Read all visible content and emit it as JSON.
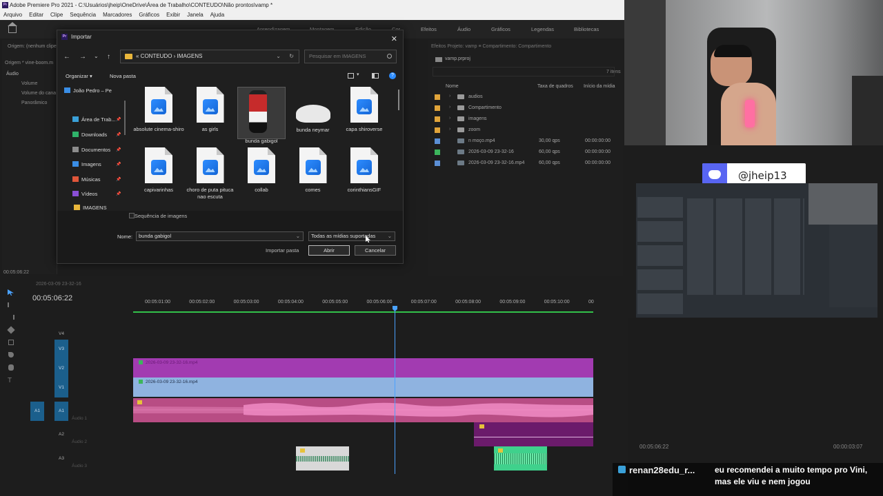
{
  "titlebar": {
    "text": "Adobe Premiere Pro 2021 - C:\\Usuários\\jheip\\OneDrive\\Área de Trabalho\\CONTEUDO\\Não prontos\\vamp *"
  },
  "menu": [
    "Arquivo",
    "Editar",
    "Clipe",
    "Sequência",
    "Marcadores",
    "Gráficos",
    "Exibir",
    "Janela",
    "Ajuda"
  ],
  "workspaces": [
    "Aprendizagem",
    "Montagem",
    "Edição",
    "Cor",
    "Efeitos",
    "Áudio",
    "Gráficos",
    "Legendas",
    "Bibliotecas"
  ],
  "source_panel": {
    "tab": "Origem: (nenhum clipe)",
    "clip": "Origem * vine-boom.m",
    "section": "Áudio",
    "rows": [
      "Volume",
      "Volume do cana",
      "Panorâmico"
    ],
    "timecode": "00:05:06:22"
  },
  "project_panel": {
    "tabs": "Efeitos    Projeto: vamp  ≡    Compartimento: Compartimento",
    "project_file": "vamp.prproj",
    "item_count": "7 itens",
    "col_name": "Nome",
    "col_fps": "Taxa de quadros",
    "col_start": "Início da mídia",
    "items": [
      {
        "name": "audios",
        "type": "folder",
        "color": "#e0a43a",
        "fps": "",
        "tc": ""
      },
      {
        "name": "Compartimento",
        "type": "folder",
        "color": "#e0a43a",
        "fps": "",
        "tc": ""
      },
      {
        "name": "imagens",
        "type": "folder",
        "color": "#e0a43a",
        "fps": "",
        "tc": ""
      },
      {
        "name": "zoom",
        "type": "folder",
        "color": "#e0a43a",
        "fps": "",
        "tc": ""
      },
      {
        "name": "n moço.mp4",
        "type": "clip",
        "color": "#5b8fd6",
        "fps": "30,00 qps",
        "tc": "00:00:00:00"
      },
      {
        "name": "2026-03-09 23-32-16",
        "type": "seq",
        "color": "#3cb55c",
        "fps": "60,00 qps",
        "tc": "00:00:00:00"
      },
      {
        "name": "2026-03-09 23-32-16.mp4",
        "type": "clip",
        "color": "#5b8fd6",
        "fps": "60,00 qps",
        "tc": "00:00:00:00"
      }
    ]
  },
  "timeline": {
    "tab": "2026-03-09 23-32-16",
    "timecode": "00:05:06:22",
    "ruler": [
      "00:05:01:00",
      "00:05:02:00",
      "00:05:03:00",
      "00:05:04:00",
      "00:05:05:00",
      "00:05:06:00",
      "00:05:07:00",
      "00:05:08:00",
      "00:05:09:00",
      "00:05:10:00",
      "00"
    ],
    "tracks_video": [
      "V4",
      "V3",
      "V2",
      "V1"
    ],
    "tracks_audio": [
      "A1",
      "A2",
      "A3"
    ],
    "source_patch_a1": "A1",
    "audio_names": [
      "Áudio 1",
      "Áudio 2",
      "Áudio 3"
    ],
    "clip_v2": "2026-03-09 23-32-16.mp4",
    "clip_v1": "2026-03-09 23-32-16.mp4",
    "colors": {
      "v2": "#a23bb1",
      "v1": "#8fb3e0",
      "a1": "#b84d84",
      "a2": "#6b1b6b",
      "a3": "#3fd18c",
      "a3b": "#d8d8d8"
    }
  },
  "dialog": {
    "title": "Importar",
    "close": "✕",
    "address": "« CONTEUDO  ›  IMAGENS",
    "search_placeholder": "Pesquisar em IMAGENS",
    "organize": "Organizar ▾",
    "new_folder": "Nova pasta",
    "sidebar": [
      {
        "label": "João Pedro – Pe",
        "color": "#3a8ee6"
      },
      {
        "label": "Área de Trab...",
        "color": "#3aa0d8"
      },
      {
        "label": "Downloads",
        "color": "#2fb36a"
      },
      {
        "label": "Documentos",
        "color": "#8c8c8c"
      },
      {
        "label": "Imagens",
        "color": "#3a8ee6"
      },
      {
        "label": "Músicas",
        "color": "#e0563a"
      },
      {
        "label": "Vídeos",
        "color": "#8a4fd6"
      },
      {
        "label": "IMAGENS",
        "color": "#e9b63b"
      }
    ],
    "files_row1": [
      "absolute cinema-shiro",
      "as girls",
      "bunda gabigol",
      "bunda neymar",
      "capa shiroverse"
    ],
    "files_row2": [
      "capivarinhas",
      "choro de puta pitucа nao escuta",
      "collab",
      "comes",
      "corinthiansGIF"
    ],
    "image_sequence": "Sequência de imagens",
    "name_label": "Nome:",
    "name_value": "bunda gabigol",
    "filter": "Todas as mídias suportadas",
    "import_folder": "Importar pasta",
    "open": "Abrir",
    "cancel": "Cancelar"
  },
  "overlay": {
    "discord_handle": "@jheip13",
    "bottom_tc_left": "00:05:06:22",
    "bottom_tc_right": "00:00:03:07",
    "chat_user": "renan28edu_r...",
    "chat_message": "eu recomendei a muito tempo pro Vini, mas ele viu e nem jogou"
  }
}
